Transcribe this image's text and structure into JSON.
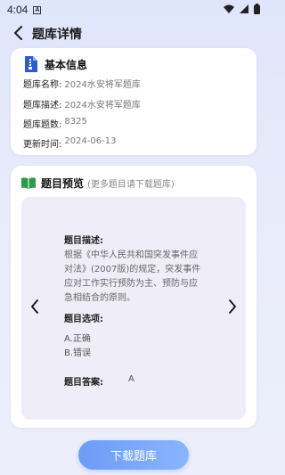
{
  "status_bar": {
    "time": "4:04",
    "notif_letter": "A"
  },
  "header": {
    "title": "题库详情"
  },
  "info_card": {
    "title": "基本信息",
    "rows": [
      {
        "label": "题库名称:",
        "value": "2024水安将军题库"
      },
      {
        "label": "题库描述:",
        "value": "2024水安将军题库"
      },
      {
        "label": "题库题数:",
        "value": "8325"
      },
      {
        "label": "更新时间:",
        "value": "2024-06-13"
      }
    ]
  },
  "preview": {
    "title": "题目预览",
    "subtitle": "(更多题目请下载题库)",
    "question": {
      "desc_label": "题目描述:",
      "desc_text": "根据《中华人民共和国突发事件应对法》(2007版)的规定，突发事件应对工作实行预防为主、预防与应急相结合的原则。",
      "options_label": "题目选项:",
      "options": [
        "A.正确",
        "B.错误"
      ],
      "answer_label": "题目答案:",
      "answer_value": "A"
    }
  },
  "download_button": {
    "label": "下载题库"
  },
  "colors": {
    "accent": "#6d9cf7",
    "book_icon": "#2e9b4a",
    "doc_icon": "#2e5cd0"
  },
  "icons": [
    "back-arrow-icon",
    "document-zip-icon",
    "book-icon",
    "chevron-left-icon",
    "chevron-right-icon",
    "wifi-icon",
    "signal-icon",
    "battery-icon"
  ]
}
